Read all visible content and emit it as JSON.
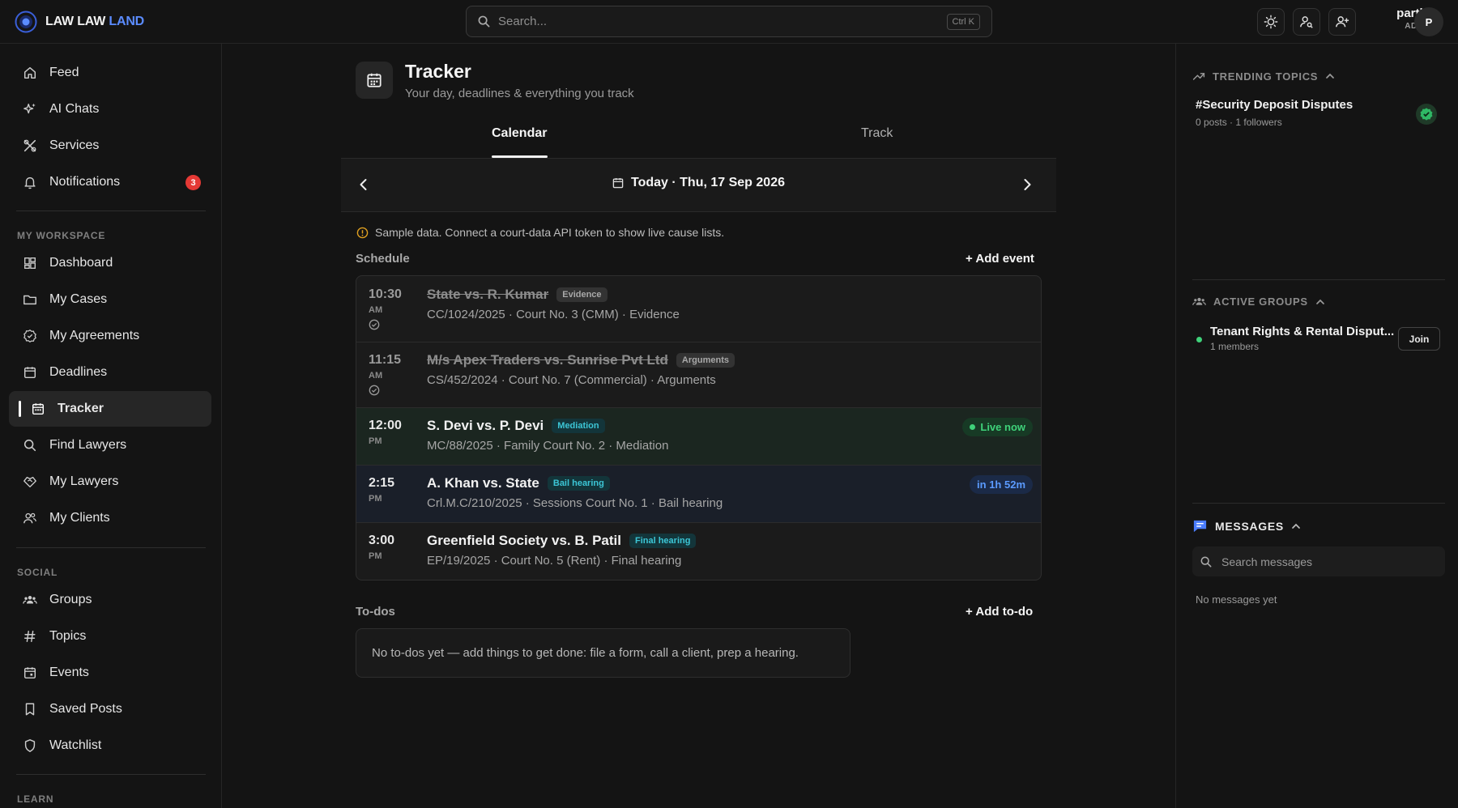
{
  "app": {
    "brand_part1": "LAW LAW ",
    "brand_part2": "LAND"
  },
  "search": {
    "placeholder": "Search...",
    "shortcut": "Ctrl K"
  },
  "user": {
    "name": "partha",
    "role": "ADMIN",
    "initial": "P"
  },
  "sidebar": {
    "items": [
      {
        "label": "Feed",
        "icon": "home-icon"
      },
      {
        "label": "AI Chats",
        "icon": "sparkles-icon"
      },
      {
        "label": "Services",
        "icon": "tools-icon"
      },
      {
        "label": "Notifications",
        "icon": "bell-icon",
        "badge": "3"
      }
    ],
    "workspace_label": "MY WORKSPACE",
    "workspace": [
      {
        "label": "Dashboard",
        "icon": "dashboard-icon"
      },
      {
        "label": "My Cases",
        "icon": "folder-icon"
      },
      {
        "label": "My Agreements",
        "icon": "badge-check-icon"
      },
      {
        "label": "Deadlines",
        "icon": "calendar-icon"
      },
      {
        "label": "Tracker",
        "icon": "calendar-icon",
        "active": true
      },
      {
        "label": "Find Lawyers",
        "icon": "search-icon"
      },
      {
        "label": "My Lawyers",
        "icon": "handshake-icon"
      },
      {
        "label": "My Clients",
        "icon": "users-icon"
      }
    ],
    "social_label": "SOCIAL",
    "social": [
      {
        "label": "Groups",
        "icon": "group-icon"
      },
      {
        "label": "Topics",
        "icon": "hash-icon"
      },
      {
        "label": "Events",
        "icon": "calendar-icon"
      },
      {
        "label": "Saved Posts",
        "icon": "bookmark-icon"
      },
      {
        "label": "Watchlist",
        "icon": "shield-icon"
      }
    ],
    "learn_label": "LEARN"
  },
  "page": {
    "title": "Tracker",
    "subtitle": "Your day, deadlines & everything you track",
    "tabs": [
      "Calendar",
      "Track"
    ],
    "date_label": "Today · Thu, 17 Sep 2026",
    "notice": "Sample data. Connect a court-data API token to show live cause lists.",
    "schedule_label": "Schedule",
    "add_event": "+ Add event",
    "todos_label": "To-dos",
    "add_todo": "+ Add to-do",
    "todos_empty": "No to-dos yet — add things to get done: file a form, call a client, prep a hearing."
  },
  "schedule": [
    {
      "time": "10:30",
      "ampm": "AM",
      "title": "State vs. R. Kumar",
      "tag": "Evidence",
      "sub": "CC/1024/2025 · Court No. 3 (CMM) · Evidence",
      "done": true
    },
    {
      "time": "11:15",
      "ampm": "AM",
      "title": "M/s Apex Traders vs. Sunrise Pvt Ltd",
      "tag": "Arguments",
      "sub": "CS/452/2024 · Court No. 7 (Commercial) · Arguments",
      "done": true
    },
    {
      "time": "12:00",
      "ampm": "PM",
      "title": "S. Devi vs. P. Devi",
      "tag": "Mediation",
      "sub": "MC/88/2025 · Family Court No. 2 · Mediation",
      "status": "Live now"
    },
    {
      "time": "2:15",
      "ampm": "PM",
      "title": "A. Khan vs. State",
      "tag": "Bail hearing",
      "sub": "Crl.M.C/210/2025 · Sessions Court No. 1 · Bail hearing",
      "status": "in 1h 52m"
    },
    {
      "time": "3:00",
      "ampm": "PM",
      "title": "Greenfield Society vs. B. Patil",
      "tag": "Final hearing",
      "sub": "EP/19/2025 · Court No. 5 (Rent) · Final hearing"
    }
  ],
  "right": {
    "trending_label": "TRENDING TOPICS",
    "topic_title": "#Security Deposit Disputes",
    "topic_meta": "0 posts · 1 followers",
    "groups_label": "ACTIVE GROUPS",
    "group_name": "Tenant Rights & Rental Disput...",
    "group_meta": "1 members",
    "join": "Join",
    "messages_label": "MESSAGES",
    "messages_search": "Search messages",
    "no_messages": "No messages yet"
  },
  "colors": {
    "accent": "#5b8cff",
    "live": "#3fd27a",
    "soon": "#5b9bff",
    "tag_teal": "#3cc6d6",
    "badge": "#e53935"
  }
}
